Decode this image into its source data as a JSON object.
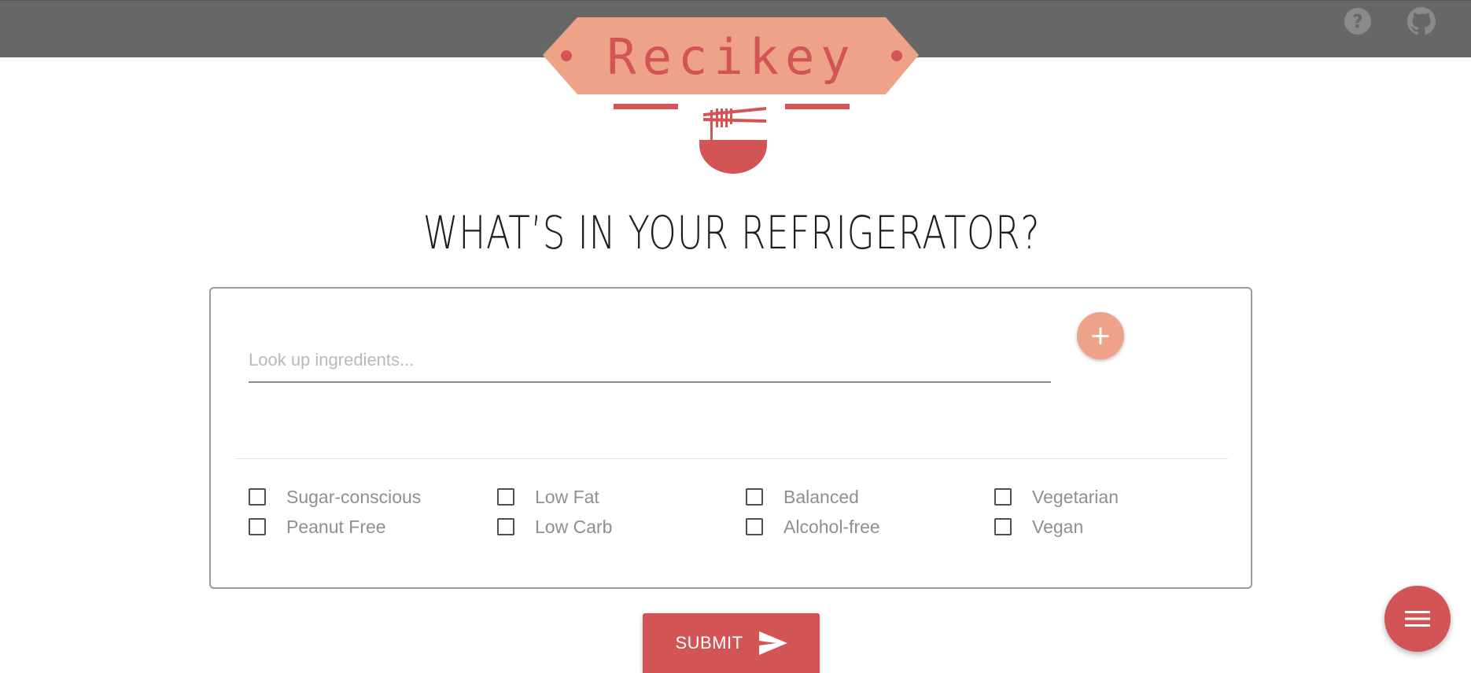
{
  "header": {
    "help_icon": "question-circle-icon",
    "github_icon": "github-icon"
  },
  "logo": {
    "text": "Recikey",
    "icon": "noodle-bowl-chopsticks-icon",
    "colors": {
      "banner": "#eea287",
      "accent": "#d25454"
    }
  },
  "main": {
    "heading": "WHAT’S IN YOUR REFRIGERATOR?"
  },
  "search": {
    "placeholder": "Look up ingredients...",
    "value": "",
    "add_label": "+"
  },
  "options": [
    {
      "label": "Sugar-conscious",
      "checked": false
    },
    {
      "label": "Low Fat",
      "checked": false
    },
    {
      "label": "Balanced",
      "checked": false
    },
    {
      "label": "Vegetarian",
      "checked": false
    },
    {
      "label": "Peanut Free",
      "checked": false
    },
    {
      "label": "Low Carb",
      "checked": false
    },
    {
      "label": "Alcohol-free",
      "checked": false
    },
    {
      "label": "Vegan",
      "checked": false
    }
  ],
  "submit": {
    "label": "SUBMIT",
    "icon": "send-icon"
  },
  "fab": {
    "icon": "hamburger-menu-icon"
  },
  "colors": {
    "topbar": "#676767",
    "primary": "#d25454",
    "secondary": "#eea287"
  }
}
